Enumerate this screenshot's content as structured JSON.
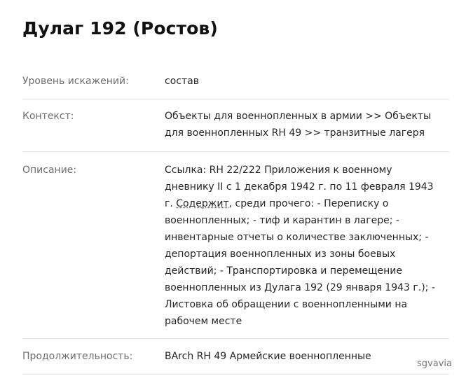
{
  "title": "Дулаг 192 (Ростов)",
  "fields": {
    "distortion": {
      "label": "Уровень искажений:",
      "value": "состав"
    },
    "context": {
      "label": "Контекст:",
      "line1": "Объекты для военнопленных в армии >> Объекты",
      "line2": "для военнопленных RH 49 >> транзитные лагеря"
    },
    "description": {
      "label": "Описание:",
      "line1": "Ссылка: RH 22/222 Приложения к военному",
      "line2": "дневнику II с 1 декабря 1942 г. по 11 февраля 1943",
      "line3_pre": "г. ",
      "line3_underlined": "Содержит",
      "line3_post": ", среди прочего: - Переписку о",
      "line4": "военнопленных; - тиф и карантин в лагере; -",
      "line5": "инвентарные отчеты о количестве заключенных; -",
      "line6": "депортация военнопленных из зоны боевых",
      "line7": "действий; - Транспортировка и перемещение",
      "line8": "военнопленных из Дулага 192 (29 января 1943 г.); -",
      "line9": "Листовка об обращении с военнопленными на",
      "line10": "рабочем месте"
    },
    "duration": {
      "label": "Продолжительность:",
      "value": "BArch RH 49 Армейские военнопленные"
    }
  },
  "watermark": "sgvavia"
}
